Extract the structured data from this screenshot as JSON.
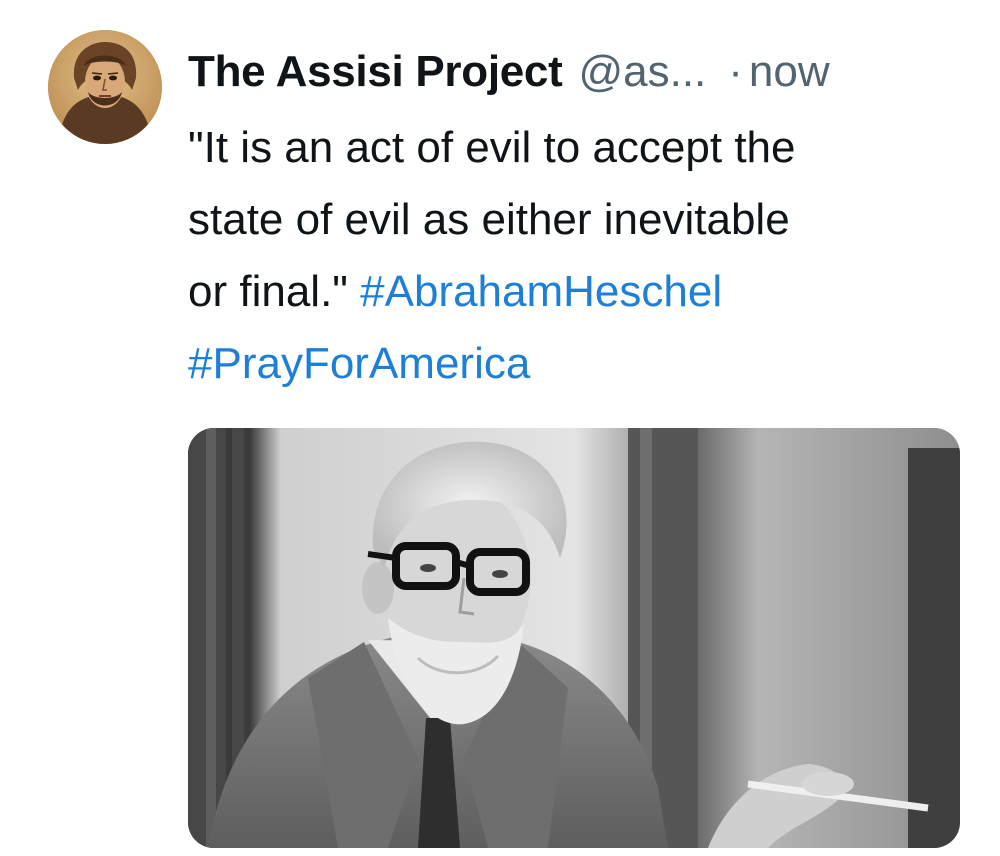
{
  "tweet": {
    "display_name": "The Assisi Project",
    "handle": "@as...",
    "separator": "·",
    "timestamp": "now",
    "text_lines": [
      "\"It is an act of evil to accept the",
      "state of evil as either inevitable",
      "or final.\" "
    ],
    "hashtags": [
      "#AbrahamHeschel",
      "#PrayForAmerica"
    ]
  },
  "colors": {
    "hashtag": "#1d7fd8",
    "secondary_text": "#536471",
    "primary_text": "#0f1419"
  },
  "icons": {
    "avatar": "saint-francis-portrait",
    "media": "black-and-white-photo-of-bearded-man-with-glasses"
  }
}
